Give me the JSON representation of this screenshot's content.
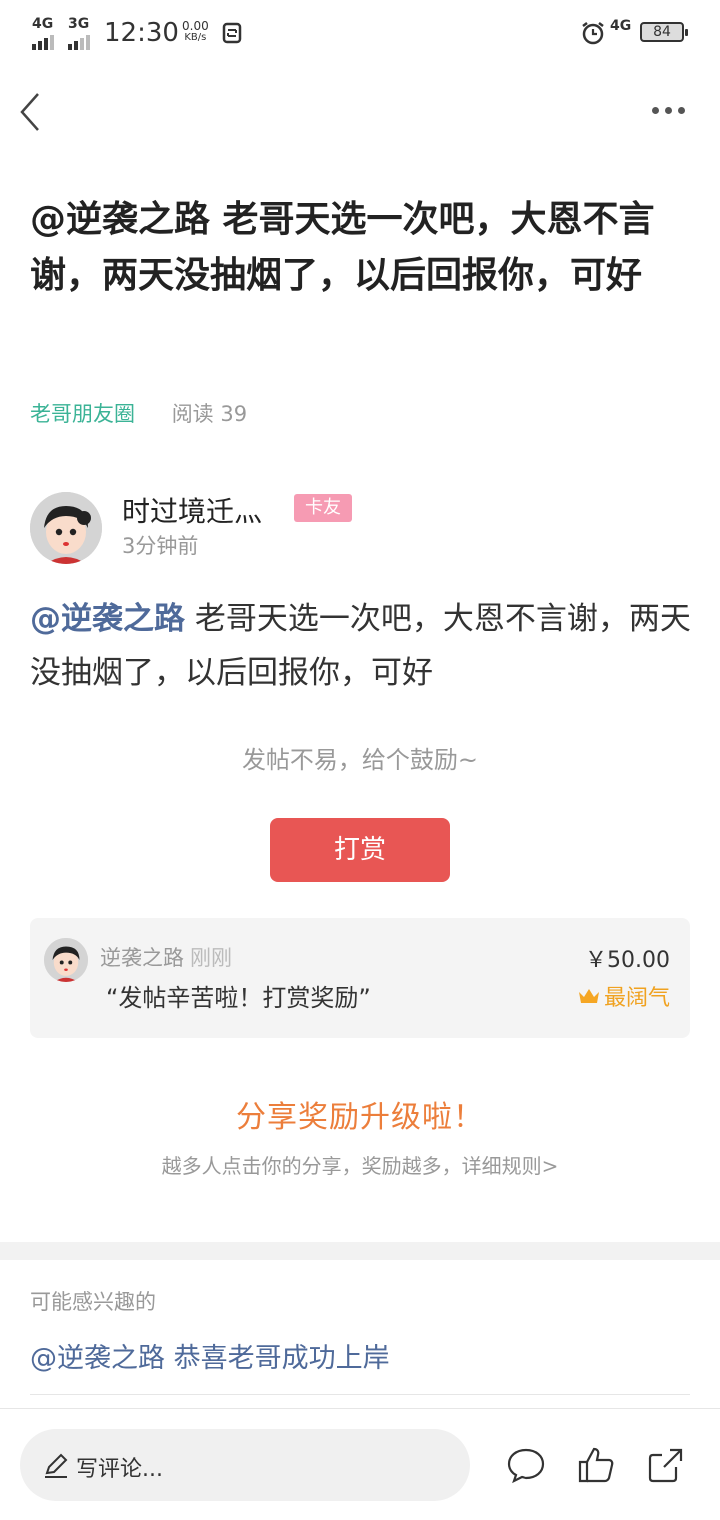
{
  "status_bar": {
    "net1": "4G",
    "net2": "3G",
    "time": "12:30",
    "speed_value": "0.00",
    "speed_unit": "KB/s",
    "net3": "4G",
    "battery": "84",
    "icons": [
      "signal-icon",
      "signal-icon",
      "sync-icon",
      "alarm-icon",
      "battery-icon"
    ]
  },
  "nav": {
    "back_icon": "chevron-left-icon",
    "more_icon": "more-dots-icon"
  },
  "post": {
    "title": "@逆袭之路 老哥天选一次吧，大恩不言谢，两天没抽烟了，以后回报你，可好",
    "circle": "老哥朋友圈",
    "reads": "阅读 39",
    "author": {
      "name": "时过境迁灬",
      "badge": "卡友",
      "time": "3分钟前"
    },
    "mention": "@逆袭之路",
    "content": " 老哥天选一次吧，大恩不言谢，两天没抽烟了，以后回报你，可好"
  },
  "reward": {
    "prompt": "发帖不易，给个鼓励~",
    "button": "打赏",
    "record": {
      "name": "逆袭之路",
      "when": "刚刚",
      "message": "“发帖辛苦啦！打赏奖励”",
      "amount": "￥50.00",
      "tag": "最阔气"
    }
  },
  "share": {
    "title": "分享奖励升级啦！",
    "desc": "越多人点击你的分享，奖励越多，详细规则>"
  },
  "interest": {
    "label": "可能感兴趣的",
    "items": [
      "@逆袭之路 恭喜老哥成功上岸"
    ]
  },
  "bottom_bar": {
    "placeholder": "写评论...",
    "icons": [
      "pen-icon",
      "comment-icon",
      "like-icon",
      "share-icon"
    ]
  },
  "colors": {
    "accent_green": "#3bb396",
    "mention_blue": "#4f6a9a",
    "reward_red": "#e85654",
    "share_orange": "#ec7e3b",
    "crown_gold": "#f0a220",
    "badge_pink": "#f69bb3"
  }
}
